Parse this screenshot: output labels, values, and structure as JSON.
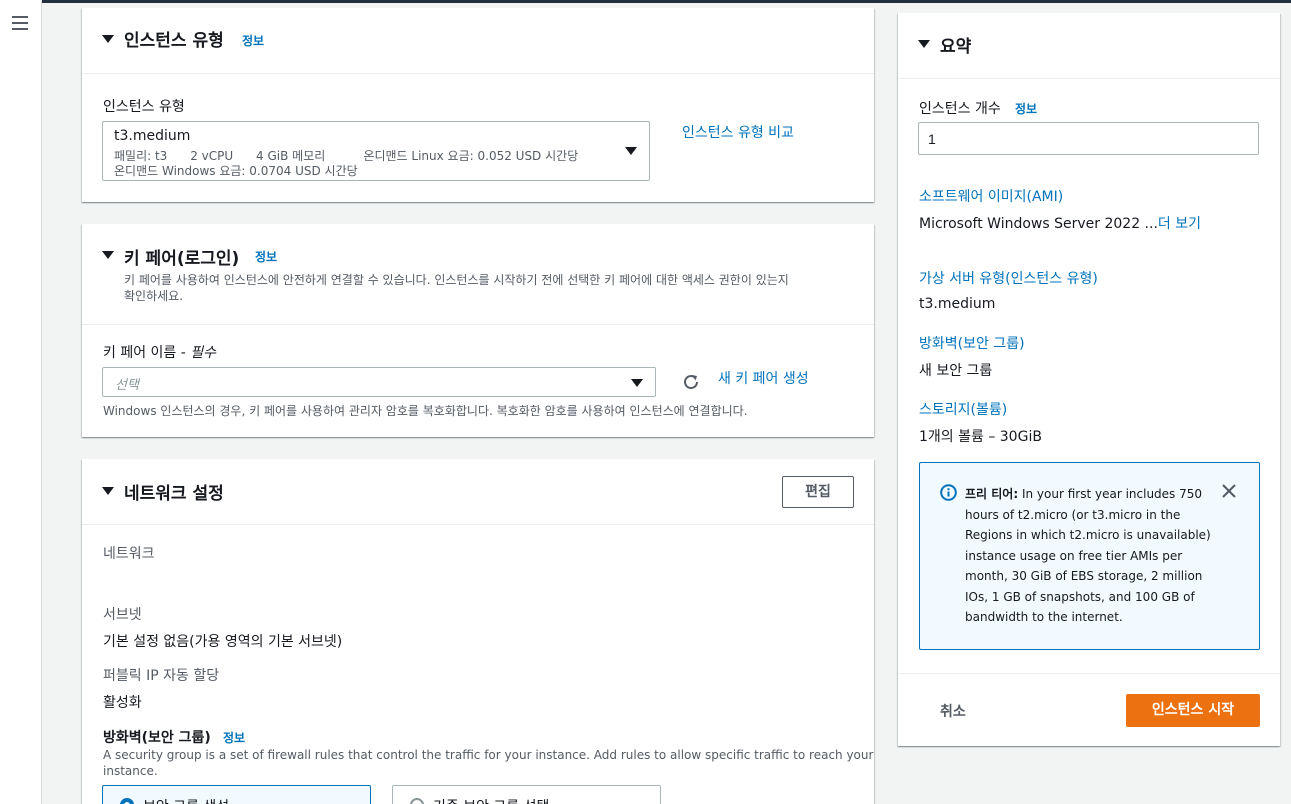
{
  "instance_type": {
    "title": "인스턴스 유형",
    "info": "정보",
    "field_label": "인스턴스 유형",
    "selected": "t3.medium",
    "details_line1": "패밀리: t3      2 vCPU      4 GiB 메모리          온디맨드 Linux 요금: 0.052 USD 시간당",
    "details_line2": "온디맨드 Windows 요금: 0.0704 USD 시간당",
    "compare_link": "인스턴스 유형 비교"
  },
  "key_pair": {
    "title": "키 페어(로그인)",
    "info": "정보",
    "description_line1": "키 페어를 사용하여 인스턴스에 안전하게 연결할 수 있습니다. 인스턴스를 시작하기 전에 선택한 키 페어에 대한 액세스 권한이 있는지",
    "description_line2": "확인하세요.",
    "field_label": "키 페어 이름 - ",
    "field_required": "필수",
    "placeholder": "선택",
    "new_link": "새 키 페어 생성",
    "hint": "Windows 인스턴스의 경우, 키 페어를 사용하여 관리자 암호를 복호화합니다. 복호화한 암호를 사용하여 인스턴스에 연결합니다."
  },
  "network": {
    "title": "네트워크 설정",
    "edit_label": "편집",
    "network_label": "네트워크",
    "network_value": "",
    "subnet_label": "서브넷",
    "subnet_value": "기본 설정 없음(가용 영역의 기본 서브넷)",
    "public_ip_label": "퍼블릭 IP 자동 할당",
    "public_ip_value": "활성화",
    "firewall_label": "방화벽(보안 그룹)",
    "firewall_info": "정보",
    "firewall_desc_line1": "A security group is a set of firewall rules that control the traffic for your instance. Add rules to allow specific traffic to reach your",
    "firewall_desc_line2": "instance.",
    "option_create": "보안 그룹 생성",
    "option_existing": "기존 보안 그룹 선택"
  },
  "summary": {
    "title": "요약",
    "count_label": "인스턴스 개수",
    "count_info": "정보",
    "count_value": "1",
    "ami_label": "소프트웨어 이미지(AMI)",
    "ami_value": "Microsoft Windows Server 2022 ...",
    "ami_more": "더 보기",
    "server_type_label": "가상 서버 유형(인스턴스 유형)",
    "server_type_value": "t3.medium",
    "firewall_label": "방화벽(보안 그룹)",
    "firewall_value": "새 보안 그룹",
    "storage_label": "스토리지(볼륨)",
    "storage_value": "1개의 볼륨 – 30GiB",
    "free_tier_title": "프리 티어:",
    "free_tier_lines": [
      "In your first year includes 750",
      "hours of t2.micro (or t3.micro in the",
      "Regions in which t2.micro is unavailable)",
      "instance usage on free tier AMIs per",
      "month, 30 GiB of EBS storage, 2 million",
      "IOs, 1 GB of snapshots, and 100 GB of",
      "bandwidth to the internet."
    ],
    "cancel_label": "취소",
    "launch_label": "인스턴스 시작"
  },
  "colors": {
    "link": "#0073bb",
    "primary_button": "#ec7211",
    "alert_bg": "#f1faff",
    "page_bg": "#f2f3f3"
  },
  "icons": [
    "menu-icon",
    "caret-down-icon",
    "refresh-icon",
    "info-circle-icon",
    "close-icon"
  ]
}
